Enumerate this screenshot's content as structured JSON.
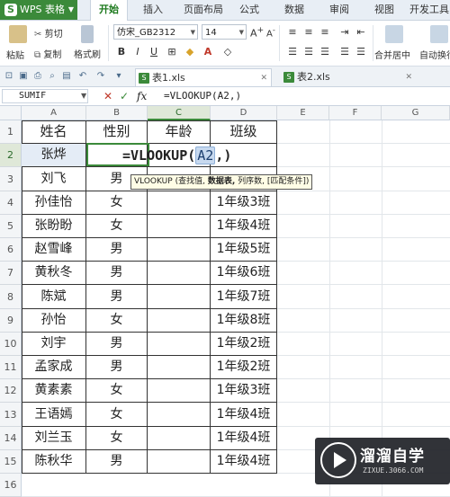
{
  "app": {
    "name": "WPS 表格"
  },
  "ribbon_tabs": [
    "开始",
    "插入",
    "页面布局",
    "公式",
    "数据",
    "审阅",
    "视图",
    "开发工具"
  ],
  "toolbar": {
    "cut": "剪切",
    "paste": "粘贴",
    "copy": "复制",
    "format_painter": "格式刷",
    "font_name": "仿宋_GB2312",
    "font_size": "14",
    "merge_center": "合并居中",
    "auto_wrap": "自动换行"
  },
  "file_tabs": [
    "表1.xls",
    "表2.xls"
  ],
  "formula_bar": {
    "name_box": "SUMIF",
    "cancel_icon": "✕",
    "confirm_icon": "✓",
    "fx_label": "fx",
    "formula": "=VLOOKUP(A2,)"
  },
  "columns": [
    "A",
    "B",
    "C",
    "D",
    "E",
    "F",
    "G"
  ],
  "rows": [
    "1",
    "2",
    "3",
    "4",
    "5",
    "6",
    "7",
    "8",
    "9",
    "10",
    "11",
    "12",
    "13",
    "14",
    "15",
    "16"
  ],
  "table": {
    "headers": [
      "姓名",
      "性别",
      "年龄",
      "班级"
    ],
    "rows": [
      [
        "张烨",
        "",
        "",
        ""
      ],
      [
        "刘飞",
        "男",
        "",
        ""
      ],
      [
        "孙佳怡",
        "女",
        "",
        "1年级3班"
      ],
      [
        "张盼盼",
        "女",
        "",
        "1年级4班"
      ],
      [
        "赵雪峰",
        "男",
        "",
        "1年级5班"
      ],
      [
        "黄秋冬",
        "男",
        "",
        "1年级6班"
      ],
      [
        "陈斌",
        "男",
        "",
        "1年级7班"
      ],
      [
        "孙怡",
        "女",
        "",
        "1年级8班"
      ],
      [
        "刘宇",
        "男",
        "",
        "1年级2班"
      ],
      [
        "孟家成",
        "男",
        "",
        "1年级2班"
      ],
      [
        "黄素素",
        "女",
        "",
        "1年级3班"
      ],
      [
        "王语嫣",
        "女",
        "",
        "1年级4班"
      ],
      [
        "刘兰玉",
        "女",
        "",
        "1年级4班"
      ],
      [
        "陈秋华",
        "男",
        "",
        "1年级4班"
      ]
    ]
  },
  "editing_cell": {
    "prefix": "=VLOOKUP(",
    "ref": "A2",
    "suffix": ",)"
  },
  "tooltip": {
    "func": "VLOOKUP",
    "arg1": "查找值,",
    "arg2": "数据表,",
    "rest": "列序数, [匹配条件])"
  },
  "watermark": {
    "title": "溜溜自学",
    "url": "ZIXUE.3066.COM"
  },
  "colors": {
    "accent": "#3b8a3a",
    "grid": "#e2e6ea",
    "selection": "#3b8a3a"
  }
}
